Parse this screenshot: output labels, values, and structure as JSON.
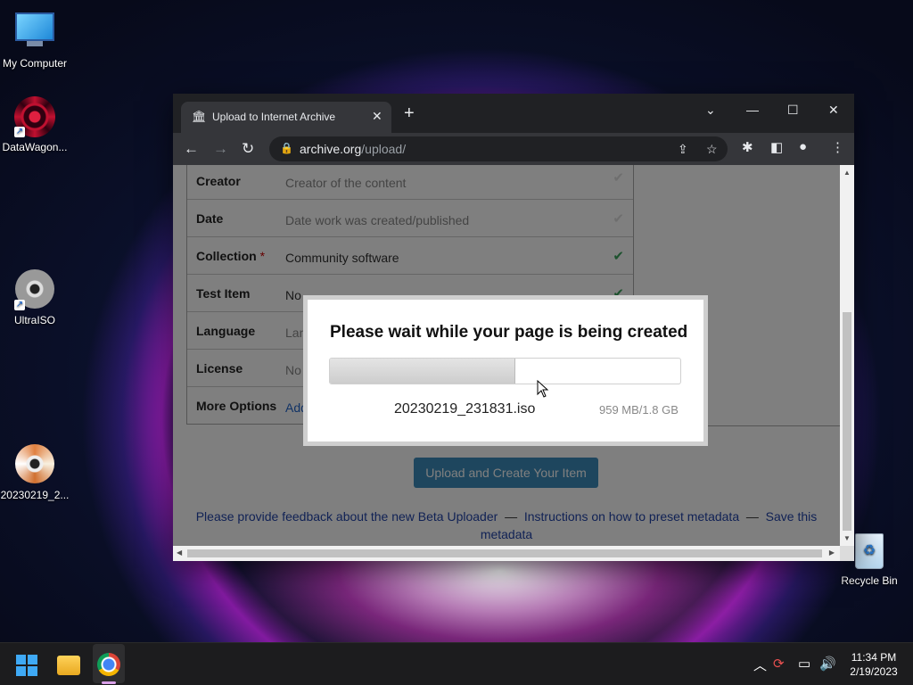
{
  "desktop": {
    "icons": [
      {
        "label": "My Computer"
      },
      {
        "label": "DataWagon..."
      },
      {
        "label": "UltraISO"
      },
      {
        "label": "20230219_2..."
      }
    ],
    "recycle_bin": "Recycle Bin"
  },
  "browser": {
    "tab_title": "Upload to Internet Archive",
    "url_host": "archive.org",
    "url_path": "/upload/"
  },
  "form": {
    "rows": [
      {
        "label": "Creator",
        "value": "Creator of the content",
        "required": false
      },
      {
        "label": "Date",
        "value": "Date work was created/published",
        "required": false
      },
      {
        "label": "Collection",
        "required_mark": "*",
        "value": "Community software",
        "required": true
      },
      {
        "label": "Test Item",
        "value": "No",
        "required": false
      },
      {
        "label": "Language",
        "value": "Lan",
        "required": false
      },
      {
        "label": "License",
        "value": "No",
        "required": false
      },
      {
        "label": "More Options",
        "value": "Add",
        "required": false
      }
    ],
    "upload_button": "Upload and Create Your Item",
    "footer": {
      "feedback_link": "Please provide feedback about the new Beta Uploader",
      "separator": "—",
      "instructions_link": "Instructions on how to preset metadata",
      "save_link": "Save this metadata"
    }
  },
  "modal": {
    "heading": "Please wait while your page is being created",
    "progress_fraction": 0.53,
    "filename": "20230219_231831.iso",
    "size_text": "959 MB/1.8 GB"
  },
  "taskbar": {
    "time": "11:34 PM",
    "date": "2/19/2023"
  },
  "colors": {
    "accent_blue": "#3c8dbc",
    "check_green": "#3aa55d",
    "link_blue": "#2244aa"
  }
}
